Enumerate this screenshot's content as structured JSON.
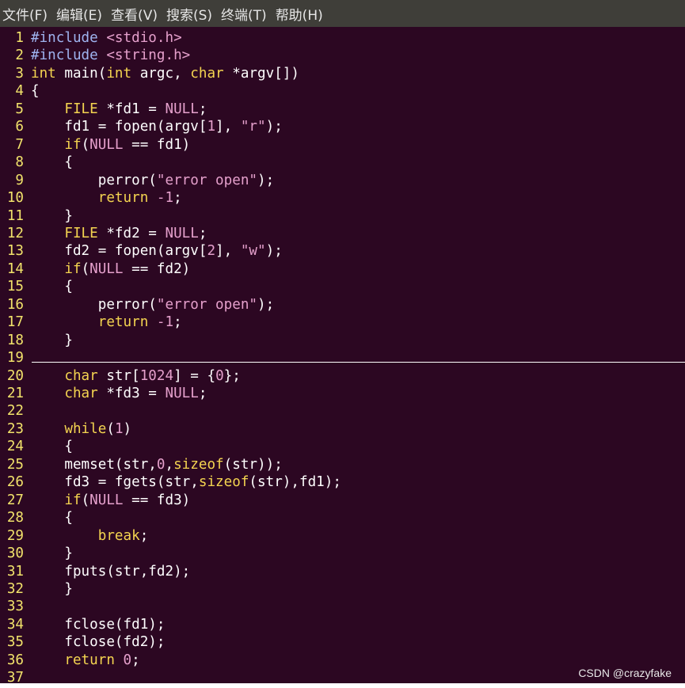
{
  "menu": [
    "文件(F)",
    "编辑(E)",
    "查看(V)",
    "搜索(S)",
    "终端(T)",
    "帮助(H)"
  ],
  "colors": {
    "editor_bg": "#2c0722",
    "menubar_bg": "#3f3e39",
    "line_number": "#f2e36b",
    "plain": "#ffffff",
    "preprocessor": "#9fb4f0",
    "string": "#e5a0cc",
    "keyword": "#f4d450"
  },
  "code_lines": [
    {
      "n": "1",
      "tokens": [
        [
          "pre",
          "#include "
        ],
        [
          "str",
          "<stdio.h>"
        ]
      ]
    },
    {
      "n": "2",
      "tokens": [
        [
          "pre",
          "#include "
        ],
        [
          "str",
          "<string.h>"
        ]
      ]
    },
    {
      "n": "3",
      "tokens": [
        [
          "kw",
          "int"
        ],
        [
          "plain",
          " main("
        ],
        [
          "kw",
          "int"
        ],
        [
          "plain",
          " argc, "
        ],
        [
          "kw",
          "char"
        ],
        [
          "plain",
          " *argv[])"
        ]
      ]
    },
    {
      "n": "4",
      "tokens": [
        [
          "plain",
          "{"
        ]
      ]
    },
    {
      "n": "5",
      "tokens": [
        [
          "kw",
          "    FILE"
        ],
        [
          "plain",
          " *fd1 = "
        ],
        [
          "str",
          "NULL"
        ],
        [
          "plain",
          ";"
        ]
      ]
    },
    {
      "n": "6",
      "tokens": [
        [
          "plain",
          "    fd1 = fopen(argv["
        ],
        [
          "num",
          "1"
        ],
        [
          "plain",
          "], "
        ],
        [
          "str",
          "\"r\""
        ],
        [
          "plain",
          ");"
        ]
      ]
    },
    {
      "n": "7",
      "tokens": [
        [
          "kw",
          "    if"
        ],
        [
          "plain",
          "("
        ],
        [
          "str",
          "NULL"
        ],
        [
          "plain",
          " == fd1)"
        ]
      ]
    },
    {
      "n": "8",
      "tokens": [
        [
          "plain",
          "    {"
        ]
      ]
    },
    {
      "n": "9",
      "tokens": [
        [
          "plain",
          "        perror("
        ],
        [
          "str",
          "\"error open\""
        ],
        [
          "plain",
          ");"
        ]
      ]
    },
    {
      "n": "10",
      "tokens": [
        [
          "kw",
          "        return"
        ],
        [
          "plain",
          " "
        ],
        [
          "num",
          "-1"
        ],
        [
          "plain",
          ";"
        ]
      ]
    },
    {
      "n": "11",
      "tokens": [
        [
          "plain",
          "    }"
        ]
      ]
    },
    {
      "n": "12",
      "tokens": [
        [
          "kw",
          "    FILE"
        ],
        [
          "plain",
          " *fd2 = "
        ],
        [
          "str",
          "NULL"
        ],
        [
          "plain",
          ";"
        ]
      ]
    },
    {
      "n": "13",
      "tokens": [
        [
          "plain",
          "    fd2 = fopen(argv["
        ],
        [
          "num",
          "2"
        ],
        [
          "plain",
          "], "
        ],
        [
          "str",
          "\"w\""
        ],
        [
          "plain",
          ");"
        ]
      ]
    },
    {
      "n": "14",
      "tokens": [
        [
          "kw",
          "    if"
        ],
        [
          "plain",
          "("
        ],
        [
          "str",
          "NULL"
        ],
        [
          "plain",
          " == fd2)"
        ]
      ]
    },
    {
      "n": "15",
      "tokens": [
        [
          "plain",
          "    {"
        ]
      ]
    },
    {
      "n": "16",
      "tokens": [
        [
          "plain",
          "        perror("
        ],
        [
          "str",
          "\"error open\""
        ],
        [
          "plain",
          ");"
        ]
      ]
    },
    {
      "n": "17",
      "tokens": [
        [
          "kw",
          "        return"
        ],
        [
          "plain",
          " "
        ],
        [
          "num",
          "-1"
        ],
        [
          "plain",
          ";"
        ]
      ]
    },
    {
      "n": "18",
      "tokens": [
        [
          "plain",
          "    }"
        ]
      ]
    },
    {
      "n": "19",
      "tokens": []
    },
    {
      "n": "20",
      "tokens": [
        [
          "kw",
          "    char"
        ],
        [
          "plain",
          " str["
        ],
        [
          "num",
          "1024"
        ],
        [
          "plain",
          "] = {"
        ],
        [
          "num",
          "0"
        ],
        [
          "plain",
          "};"
        ]
      ]
    },
    {
      "n": "21",
      "tokens": [
        [
          "kw",
          "    char"
        ],
        [
          "plain",
          " *fd3 = "
        ],
        [
          "str",
          "NULL"
        ],
        [
          "plain",
          ";"
        ]
      ]
    },
    {
      "n": "22",
      "tokens": []
    },
    {
      "n": "23",
      "tokens": [
        [
          "kw",
          "    while"
        ],
        [
          "plain",
          "("
        ],
        [
          "num",
          "1"
        ],
        [
          "plain",
          ")"
        ]
      ]
    },
    {
      "n": "24",
      "tokens": [
        [
          "plain",
          "    {"
        ]
      ]
    },
    {
      "n": "25",
      "tokens": [
        [
          "plain",
          "    memset(str,"
        ],
        [
          "num",
          "0"
        ],
        [
          "plain",
          ","
        ],
        [
          "kw",
          "sizeof"
        ],
        [
          "plain",
          "(str));"
        ]
      ]
    },
    {
      "n": "26",
      "tokens": [
        [
          "plain",
          "    fd3 = fgets(str,"
        ],
        [
          "kw",
          "sizeof"
        ],
        [
          "plain",
          "(str),fd1);"
        ]
      ]
    },
    {
      "n": "27",
      "tokens": [
        [
          "kw",
          "    if"
        ],
        [
          "plain",
          "("
        ],
        [
          "str",
          "NULL"
        ],
        [
          "plain",
          " == fd3)"
        ]
      ]
    },
    {
      "n": "28",
      "tokens": [
        [
          "plain",
          "    {"
        ]
      ]
    },
    {
      "n": "29",
      "tokens": [
        [
          "kw",
          "        break"
        ],
        [
          "plain",
          ";"
        ]
      ]
    },
    {
      "n": "30",
      "tokens": [
        [
          "plain",
          "    }"
        ]
      ]
    },
    {
      "n": "31",
      "tokens": [
        [
          "plain",
          "    fputs(str,fd2);"
        ]
      ]
    },
    {
      "n": "32",
      "tokens": [
        [
          "plain",
          "    }"
        ]
      ]
    },
    {
      "n": "33",
      "tokens": []
    },
    {
      "n": "34",
      "tokens": [
        [
          "plain",
          "    fclose(fd1);"
        ]
      ]
    },
    {
      "n": "35",
      "tokens": [
        [
          "plain",
          "    fclose(fd2);"
        ]
      ]
    },
    {
      "n": "36",
      "tokens": [
        [
          "kw",
          "    return"
        ],
        [
          "plain",
          " "
        ],
        [
          "num",
          "0"
        ],
        [
          "plain",
          ";"
        ]
      ]
    },
    {
      "n": "37",
      "tokens": []
    }
  ],
  "watermark": "CSDN @crazyfake"
}
